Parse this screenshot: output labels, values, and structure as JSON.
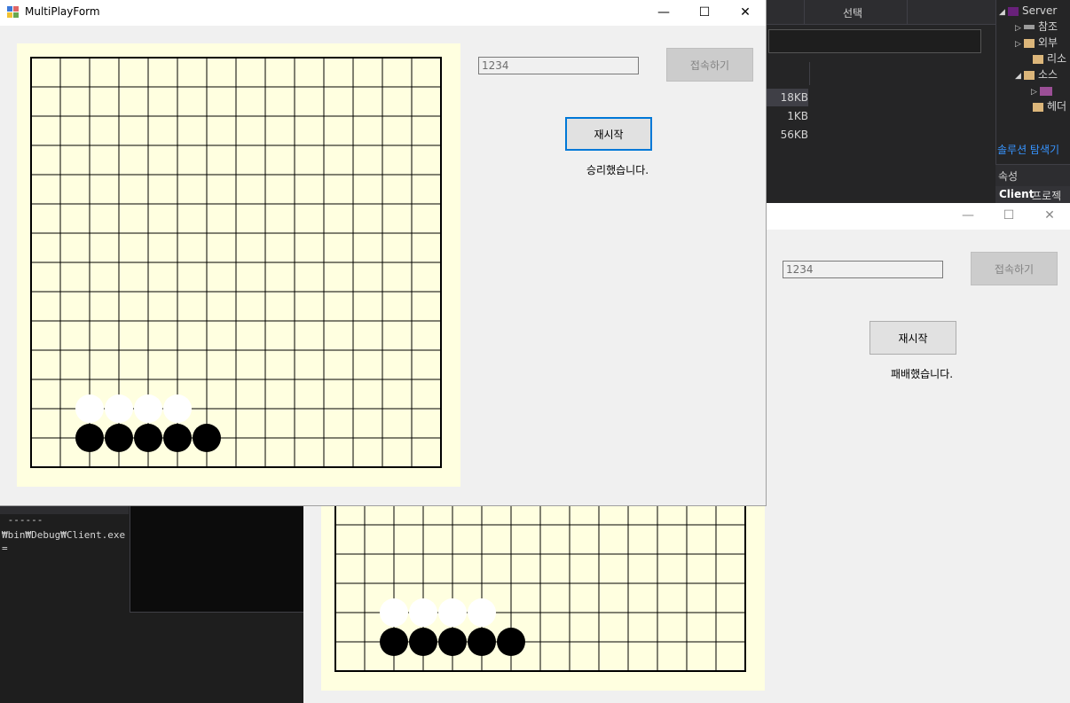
{
  "ide": {
    "header_label": "선택",
    "file_sizes": [
      "18KB",
      "1KB",
      "56KB"
    ],
    "solution_tree": [
      {
        "label": "Server",
        "arrow": "◢"
      },
      {
        "label": "참조",
        "arrow": "▷"
      },
      {
        "label": "외부",
        "arrow": "▷"
      },
      {
        "label": "리소",
        "arrow": ""
      },
      {
        "label": "소스",
        "arrow": "◢"
      },
      {
        "label": "",
        "arrow": "▷"
      },
      {
        "label": "헤더",
        "arrow": ""
      }
    ],
    "solution_explorer_tab": "솔루션 탐색기",
    "properties_title": "속성",
    "properties_row_name": "Client",
    "properties_row_value": "프로젝트",
    "output_lines": [
      " ------",
      "₩bin₩Debug₩Client.exe",
      "="
    ]
  },
  "back_window": {
    "port_value": "1234",
    "connect_button": "접속하기",
    "restart_button": "재시작",
    "status_text": "패배했습니다.",
    "caption_minimize": "—",
    "caption_maximize": "☐",
    "caption_close": "✕"
  },
  "front_window": {
    "title": "MultiPlayForm",
    "port_value": "1234",
    "connect_button": "접속하기",
    "restart_button": "재시작",
    "status_text": "승리했습니다.",
    "caption_minimize": "—",
    "caption_maximize": "☐",
    "caption_close": "✕"
  },
  "board": {
    "board_color": "#ffffe0",
    "grid_cells": 14,
    "white_stones": [
      [
        2,
        12
      ],
      [
        3,
        12
      ],
      [
        4,
        12
      ],
      [
        5,
        12
      ]
    ],
    "black_stones": [
      [
        2,
        13
      ],
      [
        3,
        13
      ],
      [
        4,
        13
      ],
      [
        5,
        13
      ],
      [
        6,
        13
      ]
    ]
  },
  "colors": {
    "accent": "#0078d7",
    "ide_background": "#1e1e1e",
    "form_background": "#f0f0f0"
  }
}
